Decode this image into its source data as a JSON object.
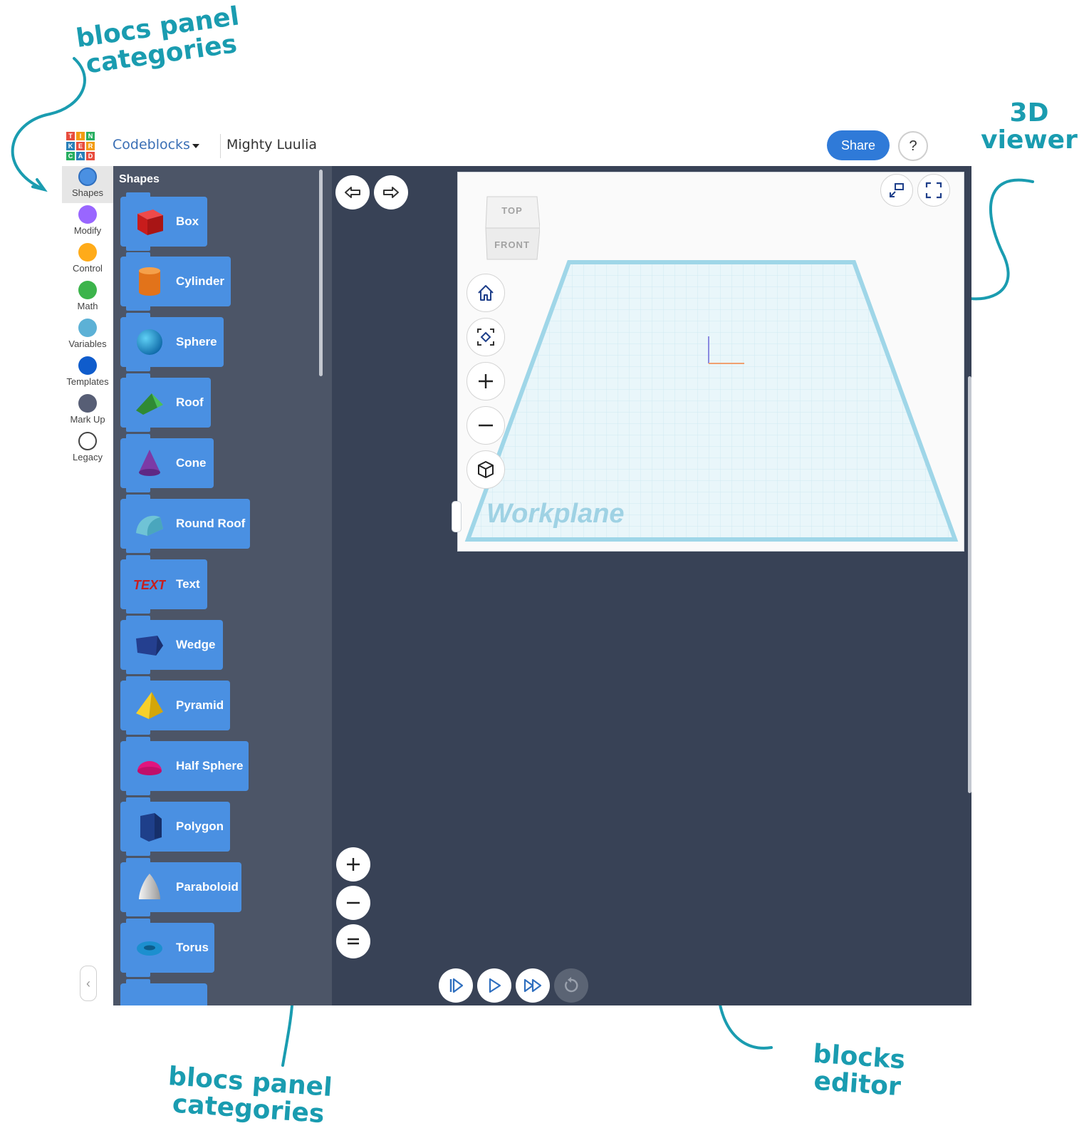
{
  "annotations": {
    "top_left": [
      "blocs panel",
      "categories"
    ],
    "top_right": [
      "3D",
      "viewer"
    ],
    "bottom_left": [
      "blocs panel",
      "categories"
    ],
    "bottom_right": [
      "blocks",
      "editor"
    ]
  },
  "header": {
    "logo_letters": [
      "T",
      "I",
      "N",
      "K",
      "E",
      "R",
      "C",
      "A",
      "D"
    ],
    "app_name": "Codeblocks",
    "project_name": "Mighty Luulia",
    "share_label": "Share",
    "help_label": "?"
  },
  "categories": [
    {
      "label": "Shapes",
      "color": "#4a90e2",
      "active": true
    },
    {
      "label": "Modify",
      "color": "#9966ff"
    },
    {
      "label": "Control",
      "color": "#ffab19"
    },
    {
      "label": "Math",
      "color": "#3cb44b"
    },
    {
      "label": "Variables",
      "color": "#5cb1d6"
    },
    {
      "label": "Templates",
      "color": "#0f5ccc"
    },
    {
      "label": "Mark Up",
      "color": "#575e75"
    },
    {
      "label": "Legacy",
      "color": "#ffffff"
    }
  ],
  "collapse_label": "‹",
  "panel": {
    "title": "Shapes",
    "blocks": [
      {
        "label": "Box",
        "icon": "box-icon",
        "color": "#d62020"
      },
      {
        "label": "Cylinder",
        "icon": "cylinder-icon",
        "color": "#ef7f1a"
      },
      {
        "label": "Sphere",
        "icon": "sphere-icon",
        "color": "#1690c8"
      },
      {
        "label": "Roof",
        "icon": "roof-icon",
        "color": "#3aa13f"
      },
      {
        "label": "Cone",
        "icon": "cone-icon",
        "color": "#7c3aa6"
      },
      {
        "label": "Round Roof",
        "icon": "round-roof-icon",
        "color": "#6fc3d6"
      },
      {
        "label": "Text",
        "icon": "text-icon",
        "color": "#c81e1e"
      },
      {
        "label": "Wedge",
        "icon": "wedge-icon",
        "color": "#243f8f"
      },
      {
        "label": "Pyramid",
        "icon": "pyramid-icon",
        "color": "#f2c20f"
      },
      {
        "label": "Half Sphere",
        "icon": "half-sphere-icon",
        "color": "#e0157e"
      },
      {
        "label": "Polygon",
        "icon": "polygon-icon",
        "color": "#1e3f8a"
      },
      {
        "label": "Paraboloid",
        "icon": "paraboloid-icon",
        "color": "#d0d0d0"
      },
      {
        "label": "Torus",
        "icon": "torus-icon",
        "color": "#1c8fcf"
      }
    ]
  },
  "viewer": {
    "cube_top": "TOP",
    "cube_front": "FRONT",
    "workplane_label": "Workplane"
  }
}
